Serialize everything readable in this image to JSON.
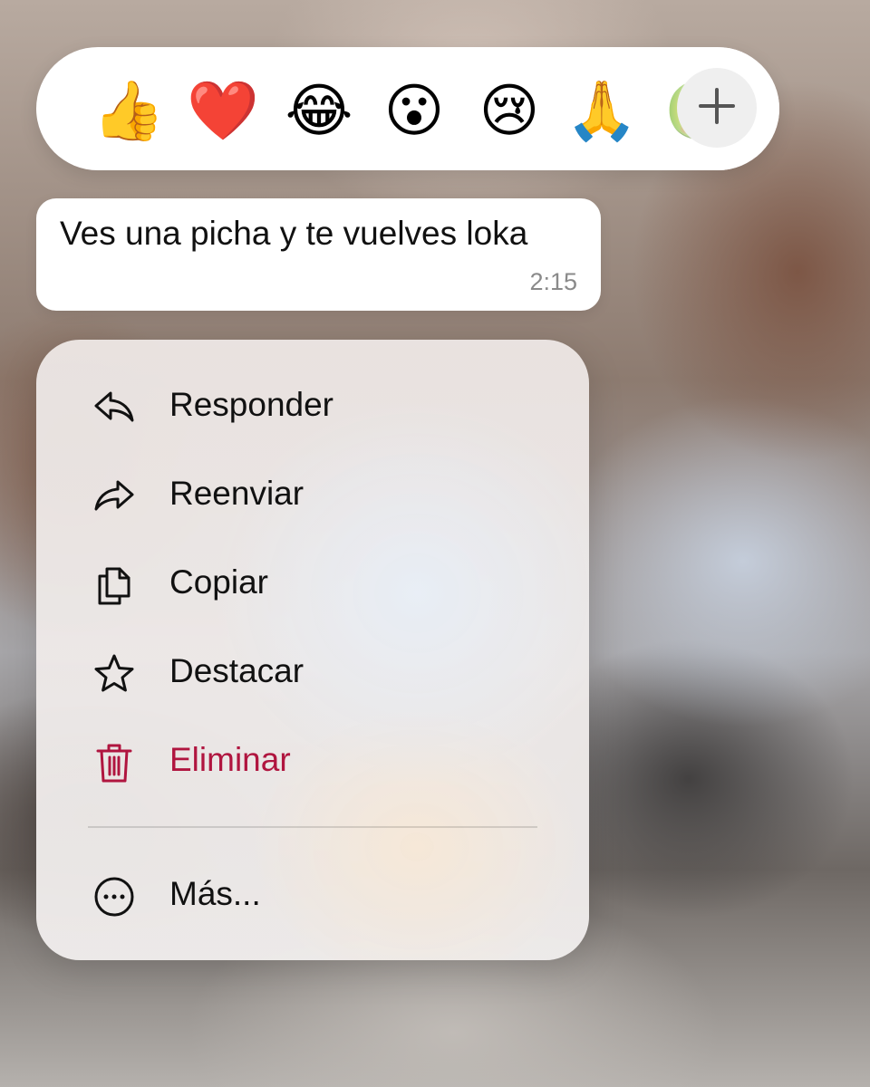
{
  "reactions": {
    "emojis": [
      {
        "name": "thumbs-up",
        "glyph": "👍"
      },
      {
        "name": "red-heart",
        "glyph": "❤️"
      },
      {
        "name": "tears-of-joy",
        "glyph": "😂"
      },
      {
        "name": "surprised-face",
        "glyph": "😮"
      },
      {
        "name": "crying-face",
        "glyph": "😢"
      },
      {
        "name": "folded-hands",
        "glyph": "🙏"
      },
      {
        "name": "nauseated-face",
        "glyph": "🤢"
      }
    ],
    "more_icon": "plus-icon"
  },
  "message": {
    "text": "Ves una picha y te vuelves loka",
    "time": "2:15"
  },
  "menu": {
    "items": [
      {
        "id": "reply",
        "label": "Responder",
        "icon": "reply-arrow-icon"
      },
      {
        "id": "forward",
        "label": "Reenviar",
        "icon": "forward-arrow-icon"
      },
      {
        "id": "copy",
        "label": "Copiar",
        "icon": "copy-icon"
      },
      {
        "id": "star",
        "label": "Destacar",
        "icon": "star-icon"
      },
      {
        "id": "delete",
        "label": "Eliminar",
        "icon": "trash-icon"
      },
      {
        "id": "more",
        "label": "Más...",
        "icon": "ellipsis-circle-icon"
      }
    ]
  },
  "colors": {
    "destructive": "#b0153f",
    "text": "#111111",
    "timestamp": "#8a8a8a",
    "bubble": "#ffffff"
  }
}
